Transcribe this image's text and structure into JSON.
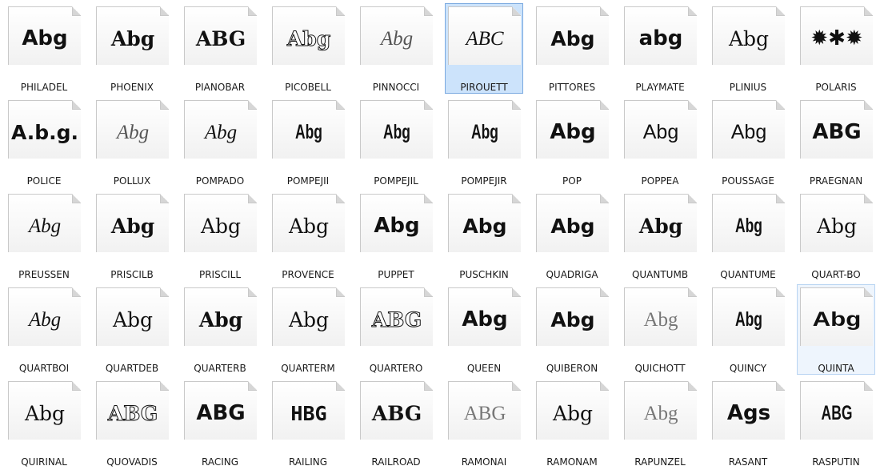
{
  "fonts": [
    {
      "name": "PHILADEL",
      "sample": "Abg",
      "style": "s-heavy"
    },
    {
      "name": "PHOENIX",
      "sample": "Abg",
      "style": "s-serifb"
    },
    {
      "name": "PIANOBAR",
      "sample": "ABG",
      "style": "s-serifb"
    },
    {
      "name": "PICOBELL",
      "sample": "Abg",
      "style": "s-outline"
    },
    {
      "name": "PINNOCCI",
      "sample": "Abg",
      "style": "s-thin"
    },
    {
      "name": "PIROUETT",
      "sample": "ABC",
      "style": "s-script"
    },
    {
      "name": "PITTORES",
      "sample": "Abg",
      "style": "s-bold"
    },
    {
      "name": "PLAYMATE",
      "sample": "abg",
      "style": "s-heavy"
    },
    {
      "name": "PLINIUS",
      "sample": "Abg",
      "style": "s-serif"
    },
    {
      "name": "POLARIS",
      "sample": "✹✱✹",
      "style": "s-heavy"
    },
    {
      "name": "POLICE",
      "sample": "A.b.g.",
      "style": "s-bold"
    },
    {
      "name": "POLLUX",
      "sample": "Abg",
      "style": "s-thin"
    },
    {
      "name": "POMPADO",
      "sample": "Abg",
      "style": "s-script"
    },
    {
      "name": "POMPEJII",
      "sample": "Abg",
      "style": "s-condensed"
    },
    {
      "name": "POMPEJIL",
      "sample": "Abg",
      "style": "s-condensed"
    },
    {
      "name": "POMPEJIR",
      "sample": "Abg",
      "style": "s-condensed"
    },
    {
      "name": "POP",
      "sample": "Abg",
      "style": "s-heavy"
    },
    {
      "name": "POPPEA",
      "sample": "Abg",
      "style": "s-sans"
    },
    {
      "name": "POUSSAGE",
      "sample": "Abg",
      "style": "s-sans"
    },
    {
      "name": "PRAEGNAN",
      "sample": "ABG",
      "style": "s-heavy"
    },
    {
      "name": "PREUSSEN",
      "sample": "Abg",
      "style": "s-script"
    },
    {
      "name": "PRISCILB",
      "sample": "Abg",
      "style": "s-serifb"
    },
    {
      "name": "PRISCILL",
      "sample": "Abg",
      "style": "s-serif"
    },
    {
      "name": "PROVENCE",
      "sample": "Abg",
      "style": "s-serif"
    },
    {
      "name": "PUPPET",
      "sample": "Abg",
      "style": "s-heavy"
    },
    {
      "name": "PUSCHKIN",
      "sample": "Abg",
      "style": "s-bold"
    },
    {
      "name": "QUADRIGA",
      "sample": "Abg",
      "style": "s-bold"
    },
    {
      "name": "QUANTUMB",
      "sample": "Abg",
      "style": "s-serifb"
    },
    {
      "name": "QUANTUME",
      "sample": "Abg",
      "style": "s-condensed"
    },
    {
      "name": "QUART-BO",
      "sample": "Abg",
      "style": "s-serif"
    },
    {
      "name": "QUARTBOI",
      "sample": "Abg",
      "style": "s-script"
    },
    {
      "name": "QUARTDEB",
      "sample": "Abg",
      "style": "s-serif"
    },
    {
      "name": "QUARTERB",
      "sample": "Abg",
      "style": "s-serifb"
    },
    {
      "name": "QUARTERM",
      "sample": "Abg",
      "style": "s-serif"
    },
    {
      "name": "QUARTERO",
      "sample": "ABG",
      "style": "s-outline"
    },
    {
      "name": "QUEEN",
      "sample": "Abg",
      "style": "s-heavy"
    },
    {
      "name": "QUIBERON",
      "sample": "Abg",
      "style": "s-bold"
    },
    {
      "name": "QUICHOTT",
      "sample": "Abg",
      "style": "s-light"
    },
    {
      "name": "QUINCY",
      "sample": "Abg",
      "style": "s-condensed"
    },
    {
      "name": "QUINTA",
      "sample": "Abg",
      "style": "s-wide"
    },
    {
      "name": "QUIRINAL",
      "sample": "Abg",
      "style": "s-serif"
    },
    {
      "name": "QUOVADIS",
      "sample": "ABG",
      "style": "s-outline"
    },
    {
      "name": "RACING",
      "sample": "ABG",
      "style": "s-heavy"
    },
    {
      "name": "RAILING",
      "sample": "HBG",
      "style": "s-deco"
    },
    {
      "name": "RAILROAD",
      "sample": "ABG",
      "style": "s-serifb"
    },
    {
      "name": "RAMONAI",
      "sample": "ABG",
      "style": "s-light"
    },
    {
      "name": "RAMONAM",
      "sample": "Abg",
      "style": "s-serif"
    },
    {
      "name": "RAPUNZEL",
      "sample": "Abg",
      "style": "s-light"
    },
    {
      "name": "RASANT",
      "sample": "Ags",
      "style": "s-heavy"
    },
    {
      "name": "RASPUTIN",
      "sample": "ABG",
      "style": "s-condensed"
    }
  ],
  "selected": "PIROUETT",
  "hovered": "QUINTA"
}
